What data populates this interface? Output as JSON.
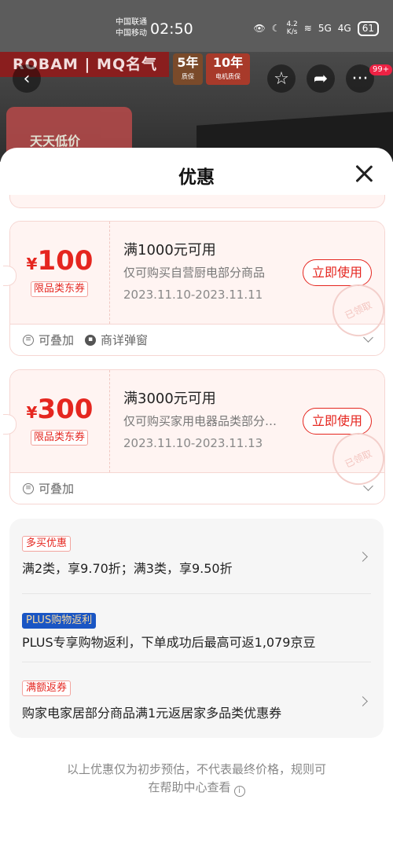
{
  "status_bar": {
    "carrier_1": "中国联通",
    "carrier_2": "中国移动",
    "time": "02:50",
    "net_speed": "4.2",
    "net_unit": "K/s",
    "signal_1": "5G",
    "signal_2": "4G",
    "battery": "61"
  },
  "background": {
    "brand": "ROBAM | MQ名气",
    "badge_5_main": "5年",
    "badge_5_sub": "质保",
    "badge_10_main": "10年",
    "badge_10_sub": "电机质保",
    "promo_text": "天天低价",
    "more_count": "99+"
  },
  "sheet": {
    "title": "优惠"
  },
  "coupons": [
    {
      "currency": "¥",
      "amount": "100",
      "tag": "限品类东券",
      "condition": "满1000元可用",
      "description": "仅可购买自营厨电部分商品",
      "dates": "2023.11.10-2023.11.11",
      "button": "立即使用",
      "stamp": "已领取",
      "features": [
        "可叠加",
        "商详弹窗"
      ]
    },
    {
      "currency": "¥",
      "amount": "300",
      "tag": "限品类东券",
      "condition": "满3000元可用",
      "description": "仅可购买家用电器品类部分商品",
      "dates": "2023.11.10-2023.11.13",
      "button": "立即使用",
      "stamp": "已领取",
      "features": [
        "可叠加"
      ]
    }
  ],
  "promotions": [
    {
      "tag": "多买优惠",
      "text": "满2类，享9.70折；满3类，享9.50折",
      "has_arrow": true
    },
    {
      "tag": "PLUS购物返利",
      "text": "PLUS专享购物返利，下单成功后最高可返1,079京豆",
      "has_arrow": false
    },
    {
      "tag": "满额返券",
      "text": "购家电家居部分商品满1元返居家多品类优惠券",
      "has_arrow": true
    }
  ],
  "footnote": {
    "line_1": "以上优惠仅为初步预估，不代表最终价格，规则可",
    "line_2": "在帮助中心查看"
  },
  "colors": {
    "accent": "#e5261f",
    "coupon_bg": "#fff4f2",
    "plus_tag_bg": "#1a56c4"
  }
}
